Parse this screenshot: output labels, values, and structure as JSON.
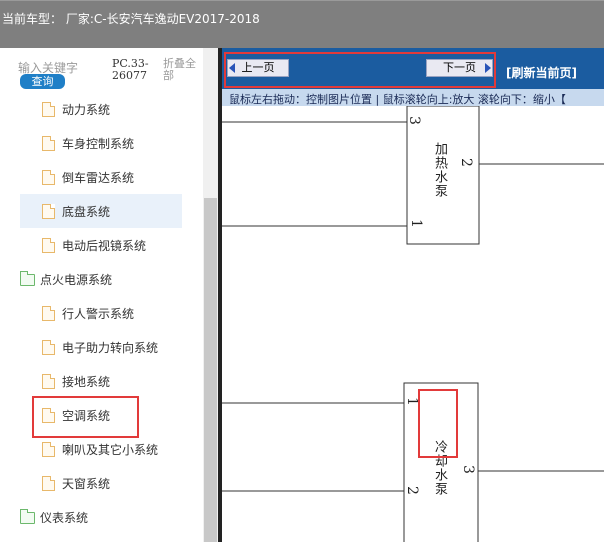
{
  "header": {
    "vehicle_info": "当前车型：  厂家:C-长安汽车逸动EV2017-2018"
  },
  "sidebar": {
    "search": {
      "placeholder": "输入关键字",
      "button": "查询"
    },
    "code": "PC.33-26077",
    "collapse_all": "折叠全部",
    "items": [
      {
        "label": "动力系统",
        "type": "file"
      },
      {
        "label": "车身控制系统",
        "type": "file"
      },
      {
        "label": "倒车雷达系统",
        "type": "file"
      },
      {
        "label": "底盘系统",
        "type": "file",
        "selected": true
      },
      {
        "label": "电动后视镜系统",
        "type": "file"
      },
      {
        "label": "点火电源系统",
        "type": "folder"
      },
      {
        "label": "行人警示系统",
        "type": "file"
      },
      {
        "label": "电子助力转向系统",
        "type": "file"
      },
      {
        "label": "接地系统",
        "type": "file"
      },
      {
        "label": "空调系统",
        "type": "file",
        "highlighted": true
      },
      {
        "label": "喇叭及其它小系统",
        "type": "file"
      },
      {
        "label": "天窗系统",
        "type": "file"
      },
      {
        "label": "仪表系统",
        "type": "folder"
      }
    ]
  },
  "viewer": {
    "prev_button": "上一页",
    "next_button": "下一页",
    "refresh": "[刷新当前页]",
    "hint": "鼠标左右拖动：控制图片位置 | 鼠标滚轮向上:放大  滚轮向下：缩小【"
  },
  "diagram": {
    "top_component": {
      "label": "加热水泵",
      "pins": [
        "3",
        "2",
        "1"
      ]
    },
    "bottom_component": {
      "label": "冷却水泵",
      "pins": [
        "1",
        "3",
        "2"
      ]
    }
  },
  "colors": {
    "toolbar": "#1b5ca0",
    "highlight": "#e23a3a",
    "titlebar": "#7f7f7f"
  }
}
